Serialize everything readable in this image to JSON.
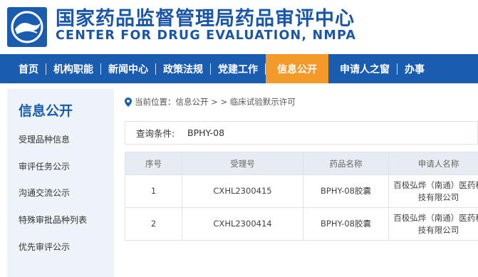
{
  "header": {
    "title_cn": "国家药品监督管理局药品审评中心",
    "title_en": "CENTER FOR DRUG EVALUATION, NMPA",
    "logo_icon": "cde-emblem-icon",
    "brand_color": "#1a5cb0"
  },
  "nav": {
    "items": [
      {
        "label": "首页"
      },
      {
        "label": "机构职能"
      },
      {
        "label": "新闻中心"
      },
      {
        "label": "政策法规"
      },
      {
        "label": "党建工作"
      },
      {
        "label": "信息公开",
        "active": true
      },
      {
        "label": "申请人之窗"
      },
      {
        "label": "办事"
      }
    ],
    "active_color": "#f39a28"
  },
  "sidebar": {
    "title": "信息公开",
    "items": [
      {
        "label": "受理品种信息"
      },
      {
        "label": "审评任务公示"
      },
      {
        "label": "沟通交流公示"
      },
      {
        "label": "特殊审批品种列表"
      },
      {
        "label": "优先审评公示"
      }
    ]
  },
  "breadcrumb": {
    "icon": "location-pin-icon",
    "text": "当前位置：信息公开 > > 临床试验默示许可"
  },
  "query": {
    "label": "查询条件:",
    "value": "BPHY-08"
  },
  "table": {
    "headers": [
      "序号",
      "受理号",
      "药品名称",
      "申请人名称"
    ],
    "rows": [
      [
        "1",
        "CXHL2300415",
        "BPHY-08胶囊",
        "百极弘烨（南通）医药科技有限公司"
      ],
      [
        "2",
        "CXHL2300414",
        "BPHY-08胶囊",
        "百极弘烨（南通）医药科技有限公司"
      ]
    ]
  }
}
